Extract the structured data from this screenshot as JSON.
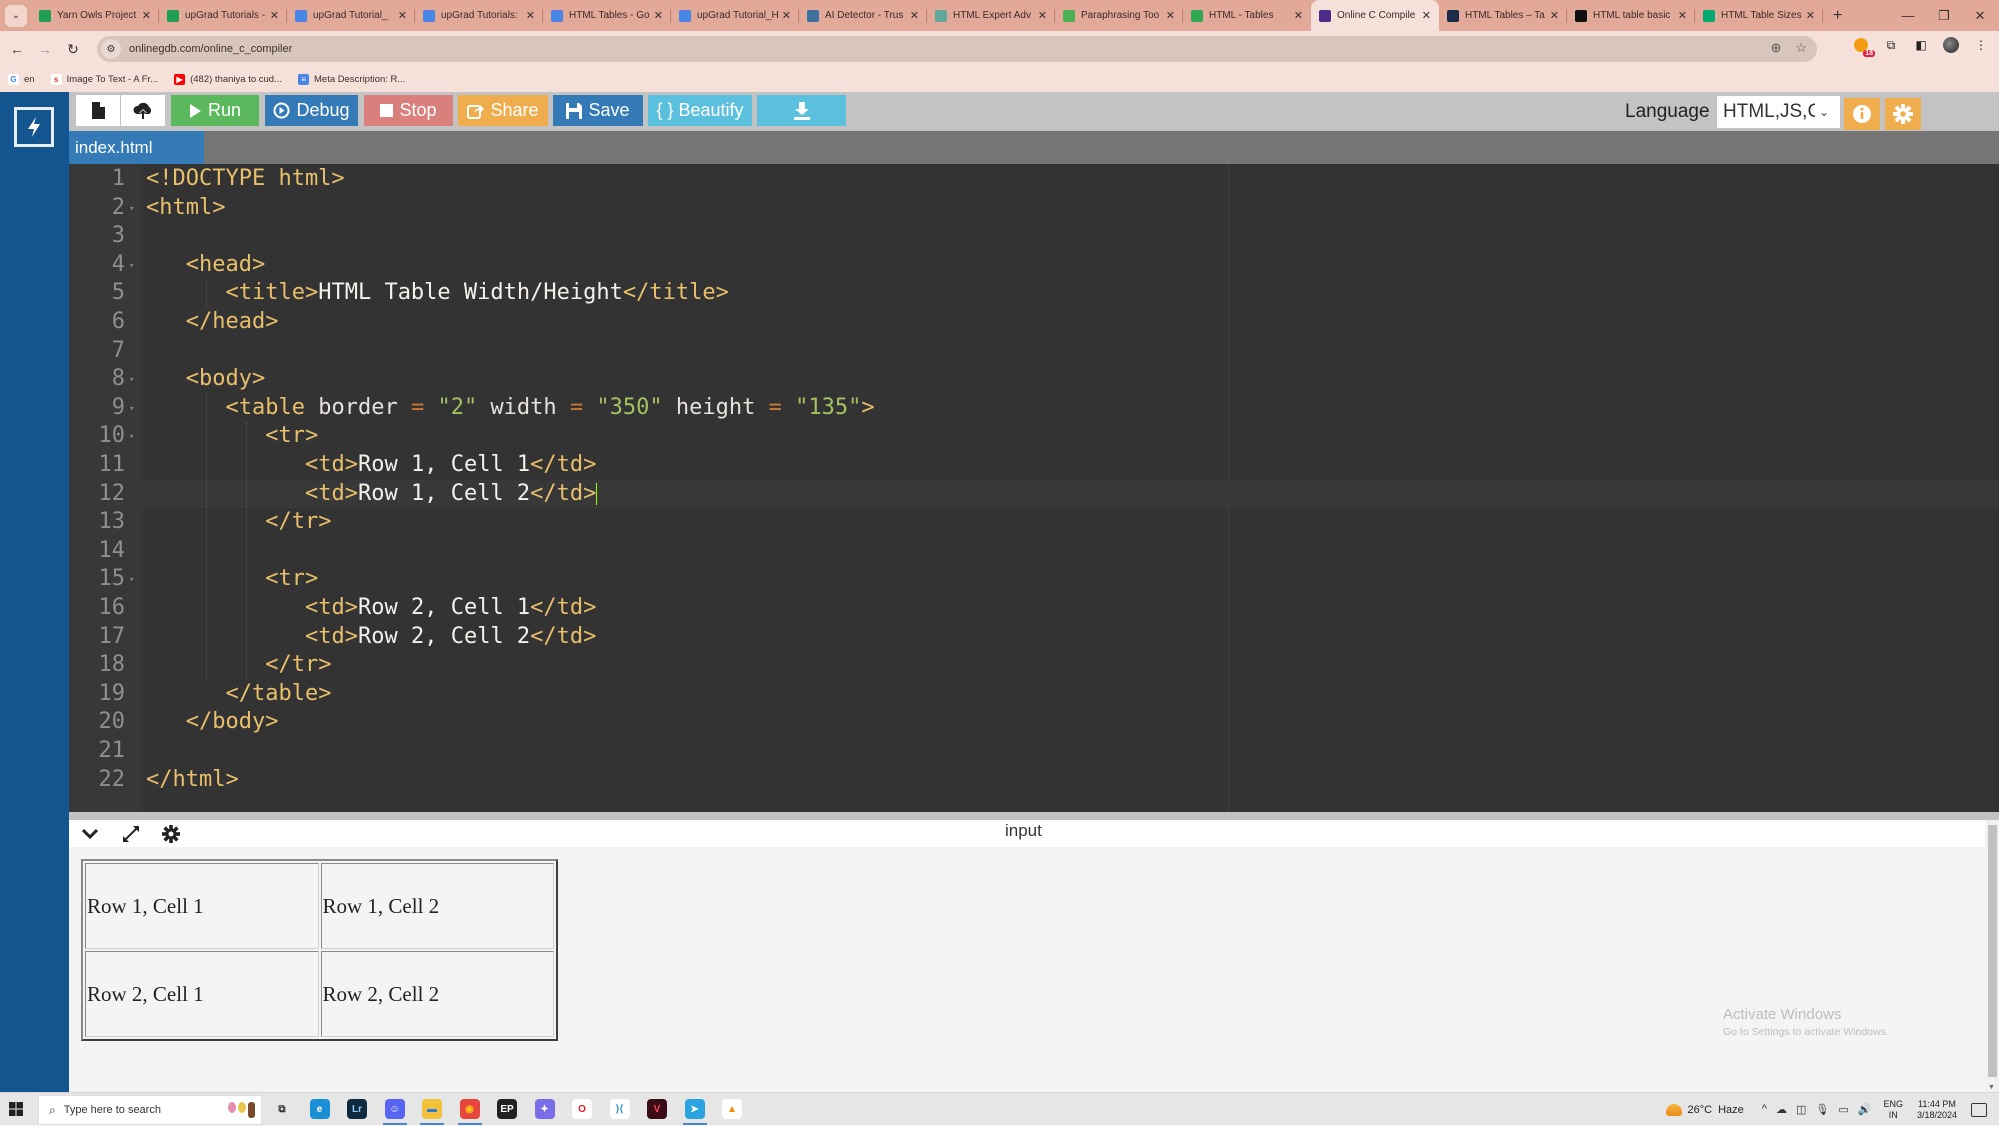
{
  "browser": {
    "tabs": [
      {
        "label": "Yarn Owls Project",
        "favicon": "sheets-icon",
        "color": "#1e9e55"
      },
      {
        "label": "upGrad Tutorials -",
        "favicon": "sheets-icon",
        "color": "#1e9e55"
      },
      {
        "label": "upGrad Tutorial_",
        "favicon": "docs-icon",
        "color": "#4a86e8"
      },
      {
        "label": "upGrad Tutorials:",
        "favicon": "docs-icon",
        "color": "#4a86e8"
      },
      {
        "label": "HTML Tables - Go",
        "favicon": "docs-icon",
        "color": "#4a86e8"
      },
      {
        "label": "upGrad Tutorial_H",
        "favicon": "docs-icon",
        "color": "#4a86e8"
      },
      {
        "label": "AI Detector - Trus",
        "favicon": "ai-detector-icon",
        "color": "#3b6fa0"
      },
      {
        "label": "HTML Expert Adv",
        "favicon": "chatgpt-icon",
        "color": "#5fa89b"
      },
      {
        "label": "Paraphrasing Too",
        "favicon": "robot-icon",
        "color": "#4caf50"
      },
      {
        "label": "HTML - Tables",
        "favicon": "tutorialspoint-icon",
        "color": "#2fa84f"
      },
      {
        "label": "Online C Compile",
        "favicon": "onlinegdb-icon",
        "color": "#4b2c8a",
        "active": true
      },
      {
        "label": "HTML Tables – Ta",
        "favicon": "a-icon",
        "color": "#1c2a4a"
      },
      {
        "label": "HTML table basic",
        "favicon": "mdn-icon",
        "color": "#111111"
      },
      {
        "label": "HTML Table Sizes",
        "favicon": "w3schools-icon",
        "color": "#04aa6d"
      }
    ],
    "url": "onlinegdb.com/online_c_compiler",
    "extension_badge": "18",
    "bookmarks": [
      {
        "label": "en",
        "icon": "google-icon"
      },
      {
        "label": "Image To Text - A Fr...",
        "icon": "sst-icon"
      },
      {
        "label": "(482) thaniya to cud...",
        "icon": "youtube-icon"
      },
      {
        "label": "Meta Description: R...",
        "icon": "docs-icon"
      }
    ]
  },
  "toolbar": {
    "run": "Run",
    "debug": "Debug",
    "stop": "Stop",
    "share": "Share",
    "save": "Save",
    "beautify": "{ } Beautify",
    "language_label": "Language",
    "language_value": "HTML,JS,CSS",
    "colors": {
      "run": "#5cb85c",
      "debug": "#337ab7",
      "stop": "#d9807c",
      "share": "#f0ad4e",
      "save": "#337ab7",
      "beautify": "#5bc0de",
      "download": "#5bc0de"
    }
  },
  "file_tab": "index.html",
  "editor": {
    "active_line": 12,
    "lines": [
      {
        "n": "1",
        "indent": 0,
        "fold": false,
        "parts": [
          [
            "tag",
            "<!DOCTYPE html>"
          ]
        ]
      },
      {
        "n": "2",
        "indent": 0,
        "fold": true,
        "parts": [
          [
            "tag",
            "<html>"
          ]
        ]
      },
      {
        "n": "3",
        "indent": 0,
        "fold": false,
        "parts": []
      },
      {
        "n": "4",
        "indent": 1,
        "fold": true,
        "parts": [
          [
            "tag",
            "<head>"
          ]
        ]
      },
      {
        "n": "5",
        "indent": 2,
        "fold": false,
        "parts": [
          [
            "tag",
            "<title>"
          ],
          [
            "txt",
            "HTML Table Width/Height"
          ],
          [
            "tag",
            "</title>"
          ]
        ]
      },
      {
        "n": "6",
        "indent": 1,
        "fold": false,
        "parts": [
          [
            "tag",
            "</head>"
          ]
        ]
      },
      {
        "n": "7",
        "indent": 0,
        "fold": false,
        "parts": []
      },
      {
        "n": "8",
        "indent": 1,
        "fold": true,
        "parts": [
          [
            "tag",
            "<body>"
          ]
        ]
      },
      {
        "n": "9",
        "indent": 2,
        "fold": true,
        "parts": [
          [
            "tag",
            "<table"
          ],
          [
            "attr",
            " border "
          ],
          [
            "op",
            "="
          ],
          [
            "str",
            " \"2\""
          ],
          [
            "attr",
            " width "
          ],
          [
            "op",
            "="
          ],
          [
            "str",
            " \"350\""
          ],
          [
            "attr",
            " height "
          ],
          [
            "op",
            "="
          ],
          [
            "str",
            " \"135\""
          ],
          [
            "tag",
            ">"
          ]
        ]
      },
      {
        "n": "10",
        "indent": 3,
        "fold": true,
        "parts": [
          [
            "tag",
            "<tr>"
          ]
        ]
      },
      {
        "n": "11",
        "indent": 4,
        "fold": false,
        "parts": [
          [
            "tag",
            "<td>"
          ],
          [
            "txt",
            "Row 1, Cell 1"
          ],
          [
            "tag",
            "</td>"
          ]
        ]
      },
      {
        "n": "12",
        "indent": 4,
        "fold": false,
        "parts": [
          [
            "tag",
            "<td>"
          ],
          [
            "txt",
            "Row 1, Cell 2"
          ],
          [
            "tag",
            "</td>"
          ]
        ],
        "cursor": true
      },
      {
        "n": "13",
        "indent": 3,
        "fold": false,
        "parts": [
          [
            "tag",
            "</tr>"
          ]
        ]
      },
      {
        "n": "14",
        "indent": 0,
        "fold": false,
        "parts": []
      },
      {
        "n": "15",
        "indent": 3,
        "fold": true,
        "parts": [
          [
            "tag",
            "<tr>"
          ]
        ]
      },
      {
        "n": "16",
        "indent": 4,
        "fold": false,
        "parts": [
          [
            "tag",
            "<td>"
          ],
          [
            "txt",
            "Row 2, Cell 1"
          ],
          [
            "tag",
            "</td>"
          ]
        ]
      },
      {
        "n": "17",
        "indent": 4,
        "fold": false,
        "parts": [
          [
            "tag",
            "<td>"
          ],
          [
            "txt",
            "Row 2, Cell 2"
          ],
          [
            "tag",
            "</td>"
          ]
        ]
      },
      {
        "n": "18",
        "indent": 3,
        "fold": false,
        "parts": [
          [
            "tag",
            "</tr>"
          ]
        ]
      },
      {
        "n": "19",
        "indent": 2,
        "fold": false,
        "parts": [
          [
            "tag",
            "</table>"
          ]
        ]
      },
      {
        "n": "20",
        "indent": 1,
        "fold": false,
        "parts": [
          [
            "tag",
            "</body>"
          ]
        ]
      },
      {
        "n": "21",
        "indent": 0,
        "fold": false,
        "parts": []
      },
      {
        "n": "22",
        "indent": 0,
        "fold": false,
        "parts": [
          [
            "tag",
            "</html>"
          ]
        ]
      }
    ]
  },
  "output_panel": {
    "title": "input",
    "table": [
      [
        "Row 1, Cell 1",
        "Row 1, Cell 2"
      ],
      [
        "Row 2, Cell 1",
        "Row 2, Cell 2"
      ]
    ]
  },
  "watermark": {
    "title": "Activate Windows",
    "subtitle": "Go to Settings to activate Windows."
  },
  "taskbar": {
    "search_placeholder": "Type here to search",
    "apps": [
      {
        "name": "task-view-icon",
        "color": "#e6e6e6",
        "glyph": "⧉",
        "fg": "#333"
      },
      {
        "name": "edge-icon",
        "color": "#1b8fd6",
        "glyph": "e",
        "fg": "#fff"
      },
      {
        "name": "lightroom-icon",
        "color": "#0f2a3d",
        "glyph": "Lr",
        "fg": "#8ec5ff"
      },
      {
        "name": "discord-icon",
        "color": "#5865f2",
        "glyph": "☺",
        "fg": "#fff",
        "running": true
      },
      {
        "name": "file-explorer-icon",
        "color": "#f3c23d",
        "glyph": "▬",
        "fg": "#2b7dd6",
        "running": true
      },
      {
        "name": "chrome-icon",
        "color": "#e8453c",
        "glyph": "◉",
        "fg": "#fbc116",
        "running": true
      },
      {
        "name": "epic-games-icon",
        "color": "#222",
        "glyph": "EP",
        "fg": "#fff"
      },
      {
        "name": "copilot-icon",
        "color": "#7a6de8",
        "glyph": "✦",
        "fg": "#fff"
      },
      {
        "name": "opera-icon",
        "color": "#ffffff",
        "glyph": "O",
        "fg": "#e41b23"
      },
      {
        "name": "vscode-icon",
        "color": "#ffffff",
        "glyph": "⟩⟨",
        "fg": "#1f8ad2"
      },
      {
        "name": "valorant-icon",
        "color": "#3a0d16",
        "glyph": "V",
        "fg": "#ff4655"
      },
      {
        "name": "telegram-icon",
        "color": "#2aa3e0",
        "glyph": "➤",
        "fg": "#fff",
        "running": true
      },
      {
        "name": "vlc-icon",
        "color": "#ffffff",
        "glyph": "▲",
        "fg": "#f28b00"
      }
    ],
    "weather_temp": "26°C",
    "weather_desc": "Haze",
    "lang_top": "ENG",
    "lang_bottom": "IN",
    "time": "11:44 PM",
    "date": "3/18/2024"
  }
}
